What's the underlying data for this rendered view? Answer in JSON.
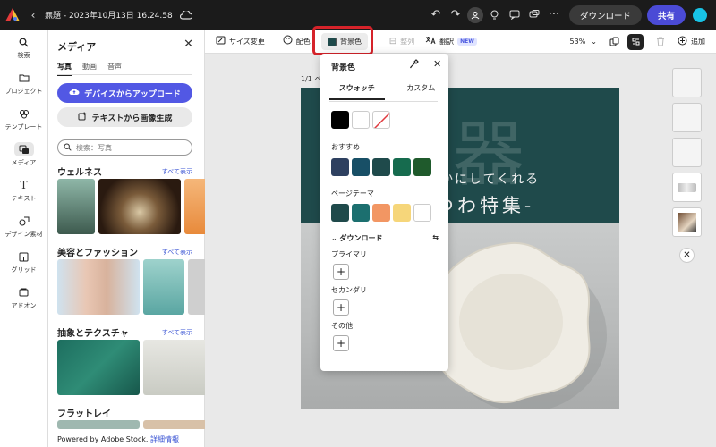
{
  "topbar": {
    "title": "無題 - 2023年10月13日 16.24.58",
    "download": "ダウンロード",
    "share": "共有"
  },
  "rail": {
    "items": [
      {
        "label": "検索",
        "icon": "search-icon"
      },
      {
        "label": "プロジェクト",
        "icon": "folder-icon"
      },
      {
        "label": "テンプレート",
        "icon": "template-icon"
      },
      {
        "label": "メディア",
        "icon": "media-icon"
      },
      {
        "label": "テキスト",
        "icon": "text-icon"
      },
      {
        "label": "デザイン素材",
        "icon": "shapes-icon"
      },
      {
        "label": "グリッド",
        "icon": "grid-icon"
      },
      {
        "label": "アドオン",
        "icon": "addon-icon"
      }
    ]
  },
  "panel": {
    "title": "メディア",
    "tabs": [
      "写真",
      "動画",
      "音声"
    ],
    "upload": "デバイスからアップロード",
    "generate": "テキストから画像生成",
    "search_placeholder": "検索：写真",
    "sections": [
      {
        "title": "ウェルネス",
        "see_all": "すべて表示"
      },
      {
        "title": "美容とファッション",
        "see_all": "すべて表示"
      },
      {
        "title": "抽象とテクスチャ",
        "see_all": "すべて表示"
      },
      {
        "title": "フラットレイ",
        "see_all": ""
      }
    ],
    "footer": "Powered by Adobe Stock.",
    "footer_link": "詳細情報"
  },
  "toolbar": {
    "resize": "サイズ変更",
    "colors": "配色",
    "background": "背景色",
    "align": "整列",
    "translate": "翻訳",
    "new_badge": "NEW",
    "zoom": "53%",
    "add": "追加"
  },
  "canvas": {
    "page": "1/1 ペ",
    "line1": "豊かにしてくれる",
    "line2": "つわ特集-",
    "bg_color": "#1f4a4b"
  },
  "popup": {
    "title": "背景色",
    "tab_swatches": "スウォッチ",
    "tab_custom": "カスタム",
    "recommended": "おすすめ",
    "page_theme": "ページテーマ",
    "download_section": "ダウンロード",
    "primary": "プライマリ",
    "secondary": "セカンダリ",
    "other": "その他",
    "basic_colors": [
      "#000000",
      "#ffffff",
      "none"
    ],
    "recommended_colors": [
      "#2e4060",
      "#184f66",
      "#1f4a4b",
      "#166b4e",
      "#1f5a2c"
    ],
    "theme_colors": [
      "#1f4a4b",
      "#1c6f6f",
      "#f29663",
      "#f6d67a",
      "#ffffff"
    ]
  }
}
